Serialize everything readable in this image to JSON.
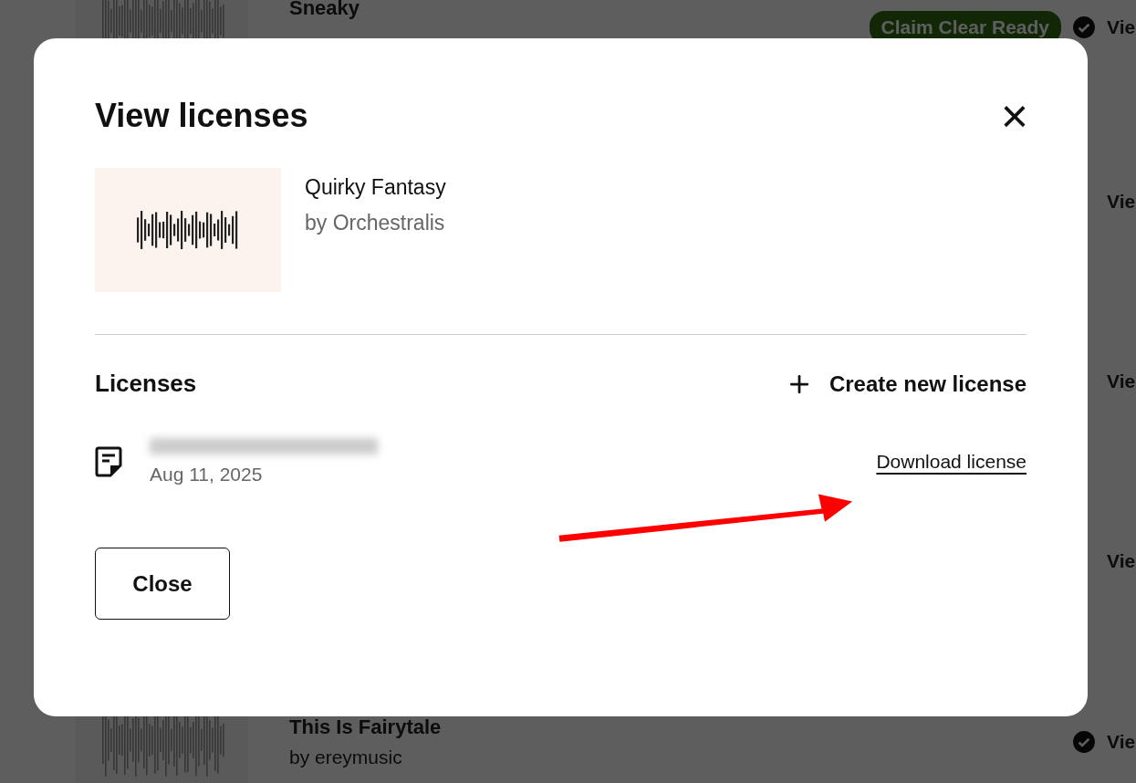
{
  "background_list": {
    "rows": [
      {
        "title": "Sneaky",
        "badge": "Claim Clear Ready",
        "verified": true,
        "action": "Vie"
      },
      {
        "action": "Vie"
      },
      {
        "action": "Vie"
      },
      {
        "action": "Vie"
      },
      {
        "title": "This Is Fairytale",
        "artist": "by ereymusic",
        "verified": true,
        "action": "Vie"
      }
    ]
  },
  "dialog": {
    "title": "View licenses",
    "close_icon": "×",
    "track": {
      "title": "Quirky Fantasy",
      "artist": "by Orchestralis"
    },
    "licenses_heading": "Licenses",
    "create_button": "Create new license",
    "licenses": [
      {
        "date": "Aug 11, 2025",
        "download": "Download license"
      }
    ],
    "close_button": "Close"
  }
}
